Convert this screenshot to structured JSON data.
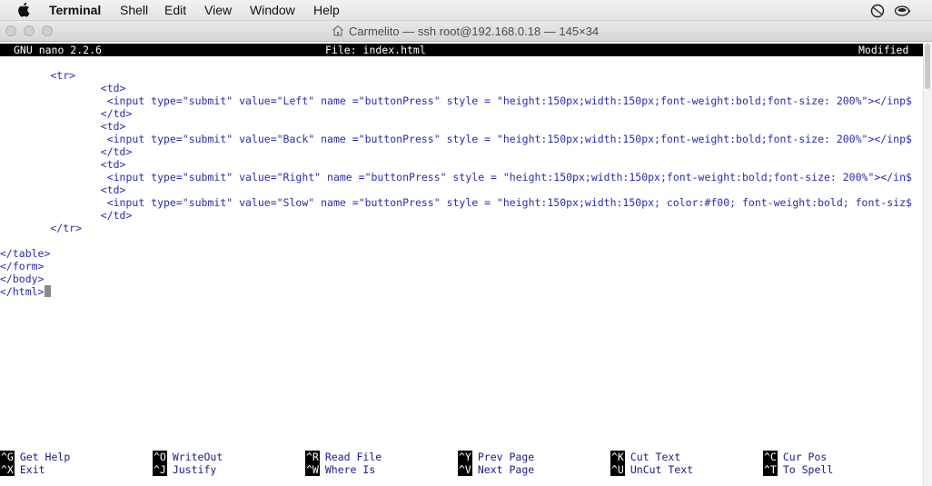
{
  "menubar": {
    "app": "Terminal",
    "items": [
      "Shell",
      "Edit",
      "View",
      "Window",
      "Help"
    ]
  },
  "window": {
    "title": "Carmelito — ssh root@192.168.0.18 — 145×34"
  },
  "nano": {
    "version": "GNU nano 2.2.6",
    "file": "File: index.html",
    "status": "Modified",
    "lines": [
      "        <tr>",
      "                <td>",
      "                 <input type=\"submit\" value=\"Left\" name =\"buttonPress\" style = \"height:150px;width:150px;font-weight:bold;font-size: 200%\"></inp$",
      "                </td>",
      "                <td>",
      "                 <input type=\"submit\" value=\"Back\" name =\"buttonPress\" style = \"height:150px;width:150px;font-weight:bold;font-size: 200%\"></inp$",
      "                </td>",
      "                <td>",
      "                 <input type=\"submit\" value=\"Right\" name =\"buttonPress\" style = \"height:150px;width:150px;font-weight:bold;font-size: 200%\"></in$",
      "                <td>",
      "                 <input type=\"submit\" value=\"Slow\" name =\"buttonPress\" style = \"height:150px;width:150px; color:#f00; font-weight:bold; font-siz$",
      "                </td>",
      "        </tr>",
      "",
      "</table>",
      "</form>",
      "</body>",
      "</html>"
    ],
    "shortcuts": [
      {
        "key": "^G",
        "label": "Get Help"
      },
      {
        "key": "^O",
        "label": "WriteOut"
      },
      {
        "key": "^R",
        "label": "Read File"
      },
      {
        "key": "^Y",
        "label": "Prev Page"
      },
      {
        "key": "^K",
        "label": "Cut Text"
      },
      {
        "key": "^C",
        "label": "Cur Pos"
      },
      {
        "key": "^X",
        "label": "Exit"
      },
      {
        "key": "^J",
        "label": "Justify"
      },
      {
        "key": "^W",
        "label": "Where Is"
      },
      {
        "key": "^V",
        "label": "Next Page"
      },
      {
        "key": "^U",
        "label": "UnCut Text"
      },
      {
        "key": "^T",
        "label": "To Spell"
      }
    ]
  }
}
